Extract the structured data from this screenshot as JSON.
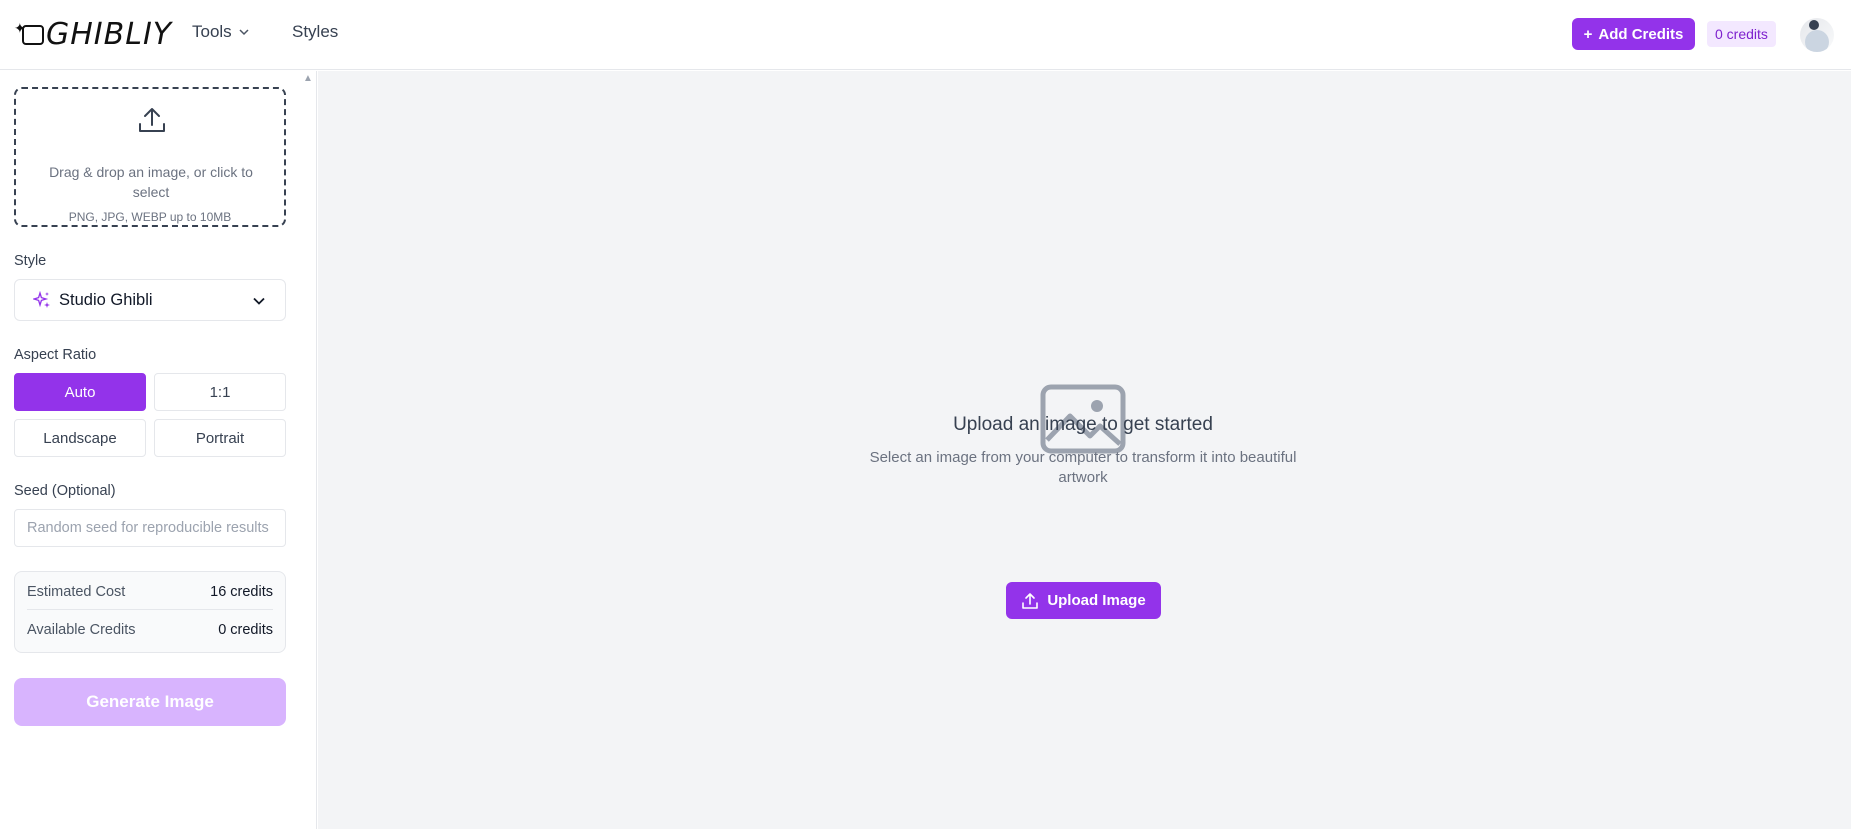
{
  "brand": {
    "name": "GHIBLIY",
    "logo_icon": "sparkle-frame-icon"
  },
  "nav": {
    "tools_label": "Tools",
    "styles_label": "Styles"
  },
  "header": {
    "add_credits_label": "Add Credits",
    "credits_badge": "0 credits"
  },
  "upload": {
    "prompt": "Drag & drop an image, or click to select",
    "formats": "PNG, JPG, WEBP up to 10MB"
  },
  "style": {
    "label": "Style",
    "selected": "Studio Ghibli",
    "icon": "sparkles-icon"
  },
  "aspect_ratio": {
    "label": "Aspect Ratio",
    "options": [
      "Auto",
      "1:1",
      "Landscape",
      "Portrait"
    ],
    "selected": "Auto"
  },
  "seed": {
    "label": "Seed (Optional)",
    "placeholder": "Random seed for reproducible results",
    "value": ""
  },
  "cost": {
    "estimated_label": "Estimated Cost",
    "estimated_value": "16 credits",
    "available_label": "Available Credits",
    "available_value": "0 credits"
  },
  "generate": {
    "label": "Generate Image"
  },
  "empty_state": {
    "title": "Upload an image to get started",
    "description": "Select an image from your computer to transform it into beautiful artwork",
    "button_label": "Upload Image"
  },
  "colors": {
    "accent": "#9333ea",
    "accent_light": "#d8b4fe",
    "badge_bg": "#f3e8ff",
    "main_bg": "#f3f4f6"
  }
}
